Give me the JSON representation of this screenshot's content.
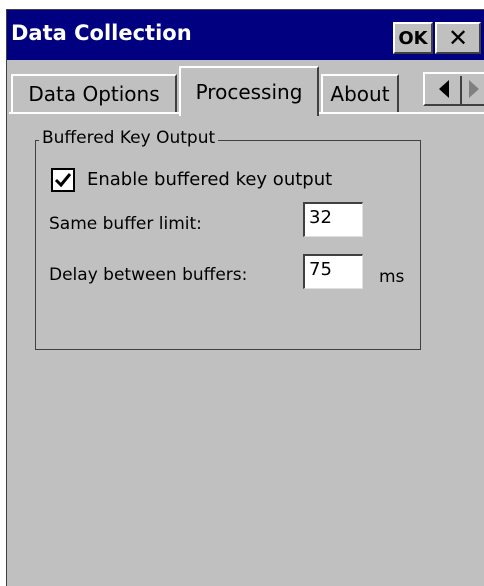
{
  "window": {
    "title": "Data Collection",
    "ok_label": "OK",
    "close_glyph": "✕"
  },
  "tabs": [
    {
      "label": "Data Options",
      "selected": false
    },
    {
      "label": "Processing",
      "selected": true
    },
    {
      "label": "About",
      "selected": false
    }
  ],
  "tab_scroll": {
    "left_icon": "triangle-left-icon",
    "right_icon": "triangle-right-icon"
  },
  "group": {
    "label": "Buffered Key Output",
    "enable_checkbox": {
      "label": "Enable buffered key output",
      "checked": true
    },
    "buffer_limit": {
      "label": "Same buffer limit:",
      "value": "32"
    },
    "delay": {
      "label": "Delay between buffers:",
      "value": "75",
      "unit": "ms"
    }
  },
  "colors": {
    "titlebar": "#000080",
    "face": "#c0c0c0",
    "shadow": "#404040",
    "highlight": "#ffffff"
  }
}
